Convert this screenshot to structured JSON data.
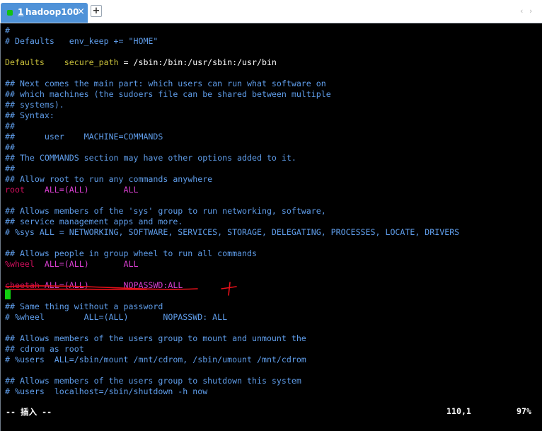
{
  "tab": {
    "number": "1",
    "title": "hadoop100",
    "close_glyph": "×",
    "status_color": "#12c212"
  },
  "new_tab_label": "+",
  "nav": {
    "left_glyph": "‹",
    "right_glyph": "›"
  },
  "colors": {
    "comment": "#5f9dea",
    "keyword": "#c8bf3a",
    "user": "#d20f5e",
    "spec": "#d93fd0",
    "text": "#ffffff",
    "cursor": "#10d010",
    "annotation": "#e8101a",
    "background": "#000000",
    "tab_active": "#4f92d8"
  },
  "editor": {
    "lines": [
      {
        "segments": [
          {
            "text": "#",
            "color": "#5f9dea"
          }
        ]
      },
      {
        "segments": [
          {
            "text": "# Defaults   env_keep += \"HOME\"",
            "color": "#5f9dea"
          }
        ]
      },
      {
        "segments": []
      },
      {
        "segments": [
          {
            "text": "Defaults",
            "color": "#c8bf3a"
          },
          {
            "text": "    ",
            "color": "#ffffff"
          },
          {
            "text": "secure_path",
            "color": "#c8bf3a"
          },
          {
            "text": " = /sbin:/bin:/usr/sbin:/usr/bin",
            "color": "#ffffff"
          }
        ]
      },
      {
        "segments": []
      },
      {
        "segments": [
          {
            "text": "## Next comes the main part: which users can run what software on",
            "color": "#5f9dea"
          }
        ]
      },
      {
        "segments": [
          {
            "text": "## which machines (the sudoers file can be shared between multiple",
            "color": "#5f9dea"
          }
        ]
      },
      {
        "segments": [
          {
            "text": "## systems).",
            "color": "#5f9dea"
          }
        ]
      },
      {
        "segments": [
          {
            "text": "## Syntax:",
            "color": "#5f9dea"
          }
        ]
      },
      {
        "segments": [
          {
            "text": "##",
            "color": "#5f9dea"
          }
        ]
      },
      {
        "segments": [
          {
            "text": "##      user    MACHINE=COMMANDS",
            "color": "#5f9dea"
          }
        ]
      },
      {
        "segments": [
          {
            "text": "##",
            "color": "#5f9dea"
          }
        ]
      },
      {
        "segments": [
          {
            "text": "## The COMMANDS section may have other options added to it.",
            "color": "#5f9dea"
          }
        ]
      },
      {
        "segments": [
          {
            "text": "##",
            "color": "#5f9dea"
          }
        ]
      },
      {
        "segments": [
          {
            "text": "## Allow root to run any commands anywhere",
            "color": "#5f9dea"
          }
        ]
      },
      {
        "segments": [
          {
            "text": "root",
            "color": "#d20f5e"
          },
          {
            "text": "    ALL=(ALL)       ALL",
            "color": "#d93fd0"
          }
        ]
      },
      {
        "segments": []
      },
      {
        "segments": [
          {
            "text": "## Allows members of the 'sys' group to run networking, software,",
            "color": "#5f9dea"
          }
        ]
      },
      {
        "segments": [
          {
            "text": "## service management apps and more.",
            "color": "#5f9dea"
          }
        ]
      },
      {
        "segments": [
          {
            "text": "# %sys ALL = NETWORKING, SOFTWARE, SERVICES, STORAGE, DELEGATING, PROCESSES, LOCATE, DRIVERS",
            "color": "#5f9dea"
          }
        ]
      },
      {
        "segments": []
      },
      {
        "segments": [
          {
            "text": "## Allows people in group wheel to run all commands",
            "color": "#5f9dea"
          }
        ]
      },
      {
        "segments": [
          {
            "text": "%wheel",
            "color": "#d20f5e"
          },
          {
            "text": "  ALL=(ALL)       ALL",
            "color": "#d93fd0"
          }
        ]
      },
      {
        "segments": []
      },
      {
        "segments": [
          {
            "text": "cheetah",
            "color": "#d20f5e"
          },
          {
            "text": " ALL=(ALL)       NOPASSWD:ALL",
            "color": "#d93fd0"
          }
        ]
      },
      {
        "segments": []
      },
      {
        "segments": [
          {
            "text": "## Same thing without a password",
            "color": "#5f9dea"
          }
        ]
      },
      {
        "segments": [
          {
            "text": "# %wheel        ALL=(ALL)       NOPASSWD: ALL",
            "color": "#5f9dea"
          }
        ]
      },
      {
        "segments": []
      },
      {
        "segments": [
          {
            "text": "## Allows members of the users group to mount and unmount the",
            "color": "#5f9dea"
          }
        ]
      },
      {
        "segments": [
          {
            "text": "## cdrom as root",
            "color": "#5f9dea"
          }
        ]
      },
      {
        "segments": [
          {
            "text": "# %users  ALL=/sbin/mount /mnt/cdrom, /sbin/umount /mnt/cdrom",
            "color": "#5f9dea"
          }
        ]
      },
      {
        "segments": []
      },
      {
        "segments": [
          {
            "text": "## Allows members of the users group to shutdown this system",
            "color": "#5f9dea"
          }
        ]
      },
      {
        "segments": [
          {
            "text": "# %users  localhost=/sbin/shutdown -h now",
            "color": "#5f9dea"
          }
        ]
      }
    ]
  },
  "status": {
    "mode": "-- 插入 --",
    "position": "110,1",
    "percent": "97%"
  }
}
